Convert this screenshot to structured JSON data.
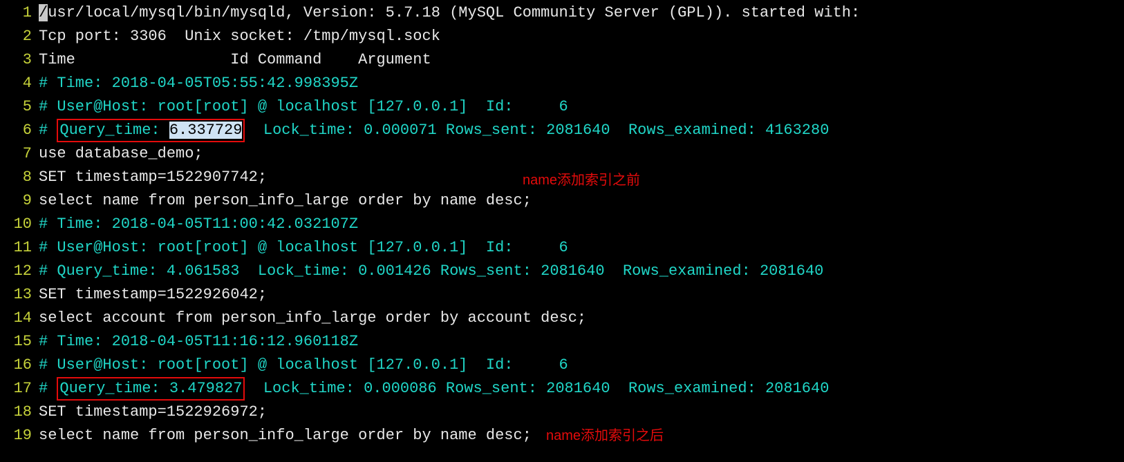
{
  "gutter": [
    "1",
    "2",
    "3",
    "4",
    "5",
    "6",
    "7",
    "8",
    "9",
    "10",
    "11",
    "12",
    "13",
    "14",
    "15",
    "16",
    "17",
    "18",
    "19"
  ],
  "line1": {
    "cursor_char": "/",
    "rest": "usr/local/mysql/bin/mysqld, Version: 5.7.18 (MySQL Community Server (GPL)). started with:"
  },
  "line2": "Tcp port: 3306  Unix socket: /tmp/mysql.sock",
  "line3": "Time                 Id Command    Argument",
  "line4": "# Time: 2018-04-05T05:55:42.998395Z",
  "line5": "# User@Host: root[root] @ localhost [127.0.0.1]  Id:     6",
  "line6": {
    "hash": "# ",
    "box_label": "Query_time: ",
    "box_value": "6.337729",
    "rest": "  Lock_time: 0.000071 Rows_sent: 2081640  Rows_examined: 4163280"
  },
  "line7": "use database_demo;",
  "line8": "SET timestamp=1522907742;",
  "line9": "select name from person_info_large order by name desc;",
  "line10": "# Time: 2018-04-05T11:00:42.032107Z",
  "line11": "# User@Host: root[root] @ localhost [127.0.0.1]  Id:     6",
  "line12": "# Query_time: 4.061583  Lock_time: 0.001426 Rows_sent: 2081640  Rows_examined: 2081640",
  "line13": "SET timestamp=1522926042;",
  "line14": "select account from person_info_large order by account desc;",
  "line15": "# Time: 2018-04-05T11:16:12.960118Z",
  "line16": "# User@Host: root[root] @ localhost [127.0.0.1]  Id:     6",
  "line17": {
    "hash": "# ",
    "box_text": "Query_time: 3.479827",
    "rest": "  Lock_time: 0.000086 Rows_sent: 2081640  Rows_examined: 2081640"
  },
  "line18": "SET timestamp=1522926972;",
  "line19": "select name from person_info_large order by name desc;",
  "annotations": {
    "before": "name添加索引之前",
    "after": "name添加索引之后"
  }
}
